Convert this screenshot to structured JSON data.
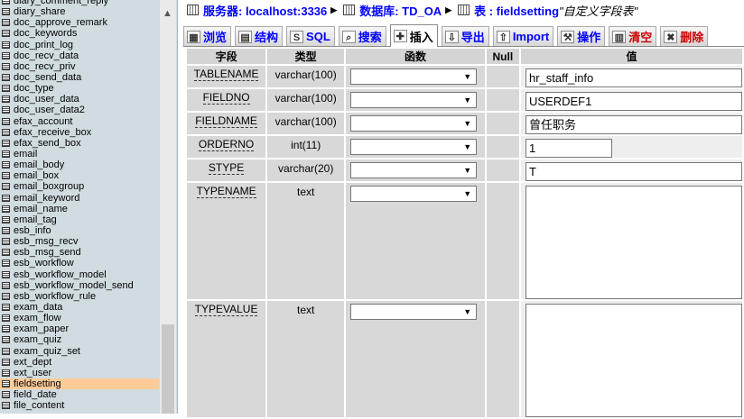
{
  "left_tables": [
    "diary_comment_reply",
    "diary_share",
    "doc_approve_remark",
    "doc_keywords",
    "doc_print_log",
    "doc_recv_data",
    "doc_recv_priv",
    "doc_send_data",
    "doc_type",
    "doc_user_data",
    "doc_user_data2",
    "efax_account",
    "efax_receive_box",
    "efax_send_box",
    "email",
    "email_body",
    "email_box",
    "email_boxgroup",
    "email_keyword",
    "email_name",
    "email_tag",
    "esb_info",
    "esb_msg_recv",
    "esb_msg_send",
    "esb_workflow",
    "esb_workflow_model",
    "esb_workflow_model_send",
    "esb_workflow_rule",
    "exam_data",
    "exam_flow",
    "exam_paper",
    "exam_quiz",
    "exam_quiz_set",
    "ext_dept",
    "ext_user",
    "fieldsetting",
    "field_date",
    "file_content"
  ],
  "selected_table": "fieldsetting",
  "breadcrumb": {
    "server": "服务器: localhost:3336",
    "database": "数据库: TD_OA",
    "table": "表 : fieldsetting",
    "comment": "\"自定义字段表\""
  },
  "tabs": [
    {
      "label": "浏览",
      "icon": "browse-icon"
    },
    {
      "label": "结构",
      "icon": "structure-icon"
    },
    {
      "label": "SQL",
      "icon": "sql-icon"
    },
    {
      "label": "搜索",
      "icon": "search-icon"
    },
    {
      "label": "插入",
      "icon": "insert-icon",
      "active": true
    },
    {
      "label": "导出",
      "icon": "export-icon"
    },
    {
      "label": "Import",
      "icon": "import-icon"
    },
    {
      "label": "操作",
      "icon": "operations-icon"
    },
    {
      "label": "清空",
      "icon": "empty-icon",
      "danger": true
    },
    {
      "label": "删除",
      "icon": "drop-icon",
      "danger": true
    }
  ],
  "columns": {
    "field": "字段",
    "type": "类型",
    "function": "函数",
    "null": "Null",
    "value": "值"
  },
  "rows": [
    {
      "field": "TABLENAME",
      "type": "varchar(100)",
      "value": "hr_staff_info",
      "input": "text"
    },
    {
      "field": "FIELDNO",
      "type": "varchar(100)",
      "value": "USERDEF1",
      "input": "text"
    },
    {
      "field": "FIELDNAME",
      "type": "varchar(100)",
      "value": "曾任职务",
      "input": "text"
    },
    {
      "field": "ORDERNO",
      "type": "int(11)",
      "value": "1",
      "input": "short"
    },
    {
      "field": "STYPE",
      "type": "varchar(20)",
      "value": "T",
      "input": "text"
    },
    {
      "field": "TYPENAME",
      "type": "text",
      "value": "",
      "input": "textarea"
    },
    {
      "field": "TYPEVALUE",
      "type": "text",
      "value": "",
      "input": "textarea"
    }
  ],
  "colors": {
    "sidebar_bg": "#d0dce0",
    "selected_row": "#ffcc99",
    "link_blue": "#0000ff",
    "danger_red": "#cc0000"
  }
}
